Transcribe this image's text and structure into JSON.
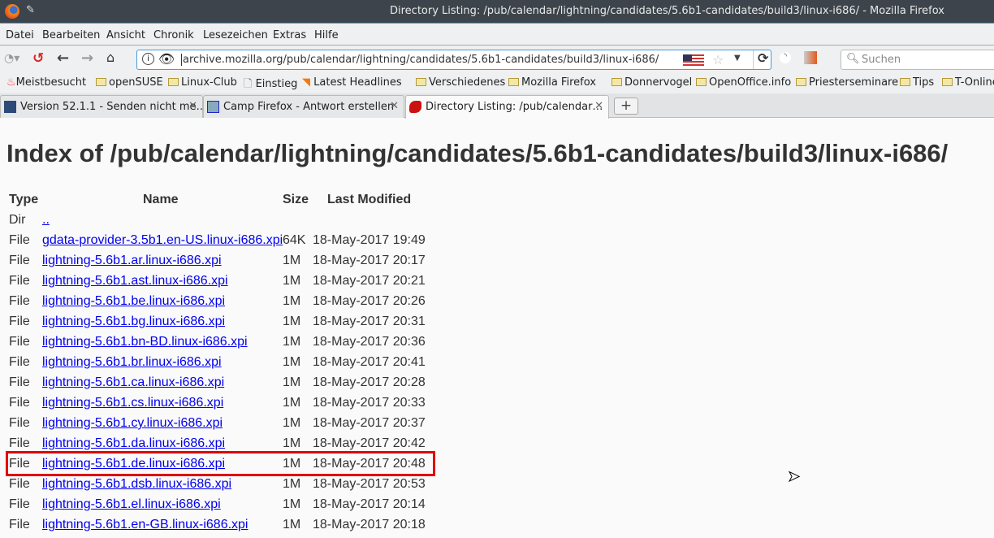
{
  "window": {
    "title": "Directory Listing: /pub/calendar/lightning/candidates/5.6b1-candidates/build3/linux-i686/ - Mozilla Firefox"
  },
  "menu": [
    "Datei",
    "Bearbeiten",
    "Ansicht",
    "Chronik",
    "Lesezeichen",
    "Extras",
    "Hilfe"
  ],
  "urlbar": {
    "url": "archive.mozilla.org/pub/calendar/lightning/candidates/5.6b1-candidates/build3/linux-i686/"
  },
  "search": {
    "placeholder": "Suchen"
  },
  "bookmarks": [
    "Meistbesucht",
    "openSUSE",
    "Linux-Club",
    "Einstieg",
    "Latest Headlines",
    "Verschiedenes",
    "Mozilla Firefox",
    "Donnervogel",
    "OpenOffice.info",
    "Priesterseminare",
    "Tips",
    "T-Online"
  ],
  "tabs": [
    {
      "label": "Version 52.1.1 - Senden nicht me…"
    },
    {
      "label": "Camp Firefox - Antwort erstellen"
    },
    {
      "label": "Directory Listing: /pub/calendar…"
    }
  ],
  "newtab": "+",
  "page": {
    "heading": "Index of /pub/calendar/lightning/candidates/5.6b1-candidates/build3/linux-i686/",
    "columns": {
      "type": "Type",
      "name": "Name",
      "size": "Size",
      "modified": "Last Modified"
    },
    "rows": [
      {
        "type": "Dir",
        "name": "..",
        "size": "",
        "modified": ""
      },
      {
        "type": "File",
        "name": "gdata-provider-3.5b1.en-US.linux-i686.xpi",
        "size": "64K",
        "modified": "18-May-2017 19:49"
      },
      {
        "type": "File",
        "name": "lightning-5.6b1.ar.linux-i686.xpi",
        "size": "1M",
        "modified": "18-May-2017 20:17"
      },
      {
        "type": "File",
        "name": "lightning-5.6b1.ast.linux-i686.xpi",
        "size": "1M",
        "modified": "18-May-2017 20:21"
      },
      {
        "type": "File",
        "name": "lightning-5.6b1.be.linux-i686.xpi",
        "size": "1M",
        "modified": "18-May-2017 20:26"
      },
      {
        "type": "File",
        "name": "lightning-5.6b1.bg.linux-i686.xpi",
        "size": "1M",
        "modified": "18-May-2017 20:31"
      },
      {
        "type": "File",
        "name": "lightning-5.6b1.bn-BD.linux-i686.xpi",
        "size": "1M",
        "modified": "18-May-2017 20:36"
      },
      {
        "type": "File",
        "name": "lightning-5.6b1.br.linux-i686.xpi",
        "size": "1M",
        "modified": "18-May-2017 20:41"
      },
      {
        "type": "File",
        "name": "lightning-5.6b1.ca.linux-i686.xpi",
        "size": "1M",
        "modified": "18-May-2017 20:28"
      },
      {
        "type": "File",
        "name": "lightning-5.6b1.cs.linux-i686.xpi",
        "size": "1M",
        "modified": "18-May-2017 20:33"
      },
      {
        "type": "File",
        "name": "lightning-5.6b1.cy.linux-i686.xpi",
        "size": "1M",
        "modified": "18-May-2017 20:37"
      },
      {
        "type": "File",
        "name": "lightning-5.6b1.da.linux-i686.xpi",
        "size": "1M",
        "modified": "18-May-2017 20:42"
      },
      {
        "type": "File",
        "name": "lightning-5.6b1.de.linux-i686.xpi",
        "size": "1M",
        "modified": "18-May-2017 20:48"
      },
      {
        "type": "File",
        "name": "lightning-5.6b1.dsb.linux-i686.xpi",
        "size": "1M",
        "modified": "18-May-2017 20:53"
      },
      {
        "type": "File",
        "name": "lightning-5.6b1.el.linux-i686.xpi",
        "size": "1M",
        "modified": "18-May-2017 20:14"
      },
      {
        "type": "File",
        "name": "lightning-5.6b1.en-GB.linux-i686.xpi",
        "size": "1M",
        "modified": "18-May-2017 20:18"
      }
    ]
  }
}
